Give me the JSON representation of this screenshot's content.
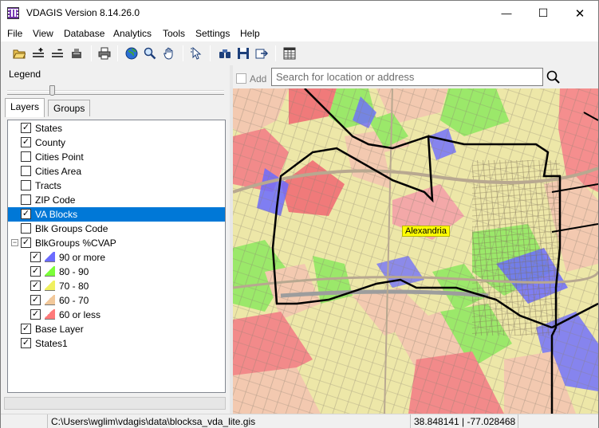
{
  "window": {
    "title": "VDAGIS Version 8.14.26.0",
    "minimize_glyph": "—",
    "maximize_glyph": "☐",
    "close_glyph": "✕"
  },
  "menu": [
    "File",
    "View",
    "Database",
    "Analytics",
    "Tools",
    "Settings",
    "Help"
  ],
  "toolbar": {
    "icons": [
      "open-folder-icon",
      "add-layer-icon",
      "remove-layer-icon",
      "clear-icon",
      "print-icon",
      "globe-icon",
      "zoom-icon",
      "pan-hand-icon",
      "select-pointer-icon",
      "binoculars-icon",
      "save-icon",
      "export-icon",
      "table-icon"
    ]
  },
  "legend": {
    "label": "Legend",
    "slider_level": 0.21
  },
  "tabs": [
    {
      "label": "Layers",
      "active": true
    },
    {
      "label": "Groups",
      "active": false
    }
  ],
  "layers": [
    {
      "label": "States",
      "checked": true,
      "indent": 0
    },
    {
      "label": "County",
      "checked": true,
      "indent": 0
    },
    {
      "label": "Cities Point",
      "checked": false,
      "indent": 0
    },
    {
      "label": "Cities Area",
      "checked": false,
      "indent": 0
    },
    {
      "label": "Tracts",
      "checked": false,
      "indent": 0
    },
    {
      "label": "ZIP Code",
      "checked": false,
      "indent": 0
    },
    {
      "label": "VA Blocks",
      "checked": true,
      "indent": 0,
      "selected": true
    },
    {
      "label": "Blk Groups Code",
      "checked": false,
      "indent": 0
    },
    {
      "label": "BlkGroups %CVAP",
      "checked": true,
      "indent": 0,
      "expanded": true
    },
    {
      "label": "90 or more",
      "checked": true,
      "indent": 1,
      "swatch": "#6b6bff"
    },
    {
      "label": "80 - 90",
      "checked": true,
      "indent": 1,
      "swatch": "#7cff3a"
    },
    {
      "label": "70 - 80",
      "checked": true,
      "indent": 1,
      "swatch": "#f0f060"
    },
    {
      "label": "60 - 70",
      "checked": true,
      "indent": 1,
      "swatch": "#f2c89a"
    },
    {
      "label": "60 or less",
      "checked": true,
      "indent": 1,
      "swatch": "#ff7a7a"
    },
    {
      "label": "Base Layer",
      "checked": true,
      "indent": 0
    },
    {
      "label": "States1",
      "checked": true,
      "indent": 0
    }
  ],
  "search": {
    "add_label": "Add",
    "placeholder": "Search for location or address"
  },
  "map": {
    "place_label": "Alexandria"
  },
  "status": {
    "path": "C:\\Users\\wglim\\vdagis\\data\\blocksa_vda_lite.gis",
    "coords": "38.848141 | -77.028468"
  },
  "colors": {
    "selection": "#0078d7",
    "cvap_90_plus": "#6b6bff",
    "cvap_80_90": "#7cff3a",
    "cvap_70_80": "#f0f060",
    "cvap_60_70": "#f2c89a",
    "cvap_60_less": "#ff7a7a"
  }
}
